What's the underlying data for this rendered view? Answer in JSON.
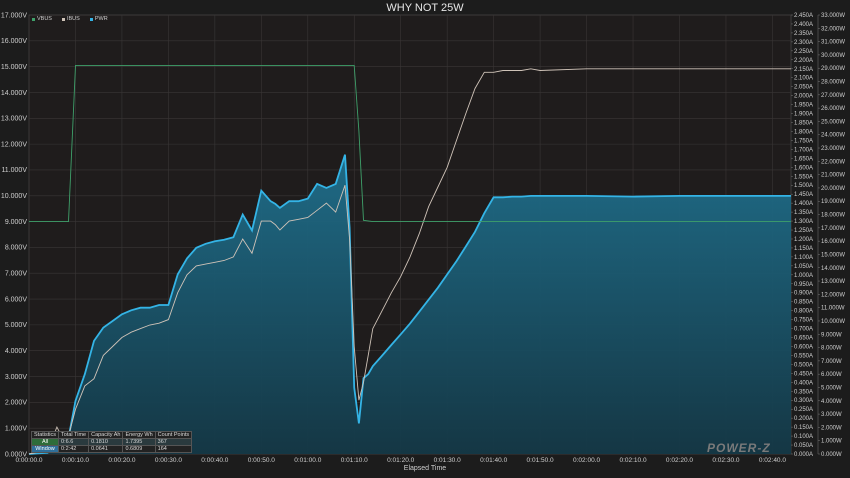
{
  "chart_data": {
    "type": "line",
    "title": "WHY NOT 25W",
    "xlabel": "Elapsed Time",
    "x_unit": "seconds",
    "xlim": [
      0,
      164
    ],
    "x_ticks": [
      0,
      10,
      20,
      30,
      40,
      50,
      60,
      70,
      80,
      90,
      100,
      110,
      120,
      130,
      140,
      150,
      160
    ],
    "x_tick_labels": [
      "0:00:00.0",
      "0:00:10.0",
      "0:00:20.0",
      "0:00:30.0",
      "0:00:40.0",
      "0:00:50.0",
      "0:01:00.0",
      "0:01:10.0",
      "0:01:20.0",
      "0:01:30.0",
      "0:01:40.0",
      "0:01:50.0",
      "0:02:00.0",
      "0:02:10.0",
      "0:02:20.0",
      "0:02:30.0",
      "0:02:40.0"
    ],
    "y_left": {
      "unit": "V",
      "ylim": [
        0,
        17
      ],
      "step": 1,
      "tick_labels": [
        "0.000V",
        "1.000V",
        "2.000V",
        "3.000V",
        "4.000V",
        "5.000V",
        "6.000V",
        "7.000V",
        "8.000V",
        "9.000V",
        "10.000V",
        "11.000V",
        "12.000V",
        "13.000V",
        "14.000V",
        "15.000V",
        "16.000V",
        "17.000V"
      ]
    },
    "y_right_current": {
      "unit": "A",
      "ylim": [
        0,
        2.45
      ],
      "step": 0.05,
      "tick_labels": [
        "0.000A",
        "0.050A",
        "0.100A",
        "0.150A",
        "0.200A",
        "0.250A",
        "0.300A",
        "0.350A",
        "0.400A",
        "0.450A",
        "0.500A",
        "0.550A",
        "0.600A",
        "0.650A",
        "0.700A",
        "0.750A",
        "0.800A",
        "0.850A",
        "0.900A",
        "0.950A",
        "1.000A",
        "1.050A",
        "1.100A",
        "1.150A",
        "1.200A",
        "1.250A",
        "1.300A",
        "1.350A",
        "1.400A",
        "1.450A",
        "1.500A",
        "1.550A",
        "1.600A",
        "1.650A",
        "1.700A",
        "1.750A",
        "1.800A",
        "1.850A",
        "1.900A",
        "1.950A",
        "2.000A",
        "2.050A",
        "2.100A",
        "2.150A",
        "2.200A",
        "2.250A",
        "2.300A",
        "2.350A",
        "2.400A",
        "2.450A"
      ]
    },
    "y_right_power": {
      "unit": "W",
      "ylim": [
        0,
        33
      ],
      "step": 1,
      "tick_labels": [
        "0.000W",
        "1.000W",
        "2.000W",
        "3.000W",
        "4.000W",
        "5.000W",
        "6.000W",
        "7.000W",
        "8.000W",
        "9.000W",
        "10.000W",
        "11.000W",
        "12.000W",
        "13.000W",
        "14.000W",
        "15.000W",
        "16.000W",
        "17.000W",
        "18.000W",
        "19.000W",
        "20.000W",
        "21.000W",
        "22.000W",
        "23.000W",
        "24.000W",
        "25.000W",
        "26.000W",
        "27.000W",
        "28.000W",
        "29.000W",
        "30.000W",
        "31.000W",
        "32.000W",
        "33.000W"
      ]
    },
    "grid": true,
    "legend_position": "top-left",
    "series": [
      {
        "name": "VBUS",
        "axis": "left",
        "color": "#3fa06a",
        "x": [
          0,
          8.5,
          10,
          70,
          71,
          72,
          74,
          164
        ],
        "y": [
          9.0,
          9.0,
          15.05,
          15.05,
          12.5,
          9.05,
          9.0,
          9.0
        ]
      },
      {
        "name": "IBUS",
        "axis": "right_current",
        "color": "#cfc3b8",
        "x": [
          0,
          4,
          6,
          8,
          10,
          12,
          14,
          16,
          18,
          20,
          22,
          24,
          26,
          28,
          30,
          32,
          34,
          36,
          38,
          40,
          42,
          44,
          46,
          48,
          50,
          52,
          53,
          54,
          56,
          58,
          60,
          62,
          64,
          66,
          68,
          69,
          70,
          71,
          72,
          73,
          74,
          76,
          78,
          80,
          82,
          84,
          86,
          88,
          90,
          92,
          94,
          96,
          98,
          100,
          102,
          104,
          106,
          108,
          110,
          120,
          130,
          140,
          150,
          160,
          164
        ],
        "y": [
          0,
          0.02,
          0.15,
          0.05,
          0.25,
          0.38,
          0.42,
          0.55,
          0.6,
          0.65,
          0.68,
          0.7,
          0.72,
          0.73,
          0.75,
          0.9,
          1.0,
          1.05,
          1.06,
          1.07,
          1.08,
          1.1,
          1.2,
          1.12,
          1.3,
          1.3,
          1.28,
          1.25,
          1.3,
          1.31,
          1.32,
          1.36,
          1.4,
          1.35,
          1.5,
          1.2,
          0.6,
          0.3,
          0.4,
          0.55,
          0.7,
          0.8,
          0.9,
          0.99,
          1.1,
          1.23,
          1.38,
          1.49,
          1.6,
          1.75,
          1.9,
          2.04,
          2.13,
          2.13,
          2.14,
          2.14,
          2.14,
          2.15,
          2.14,
          2.15,
          2.15,
          2.15,
          2.15,
          2.15,
          2.15
        ]
      },
      {
        "name": "PWR",
        "axis": "right_power",
        "color": "#34b4e6",
        "fill": true,
        "x": [
          0,
          4,
          6,
          8,
          10,
          12,
          14,
          16,
          18,
          20,
          22,
          24,
          26,
          28,
          30,
          32,
          34,
          36,
          38,
          40,
          42,
          44,
          46,
          48,
          50,
          52,
          53,
          54,
          56,
          58,
          60,
          62,
          64,
          66,
          68,
          69,
          70,
          71,
          72,
          73,
          74,
          76,
          78,
          80,
          82,
          84,
          86,
          88,
          90,
          92,
          94,
          96,
          98,
          100,
          102,
          104,
          106,
          108,
          110,
          120,
          130,
          140,
          150,
          160,
          164
        ],
        "y": [
          0,
          0.1,
          1.0,
          0.3,
          4.0,
          6.0,
          8.5,
          9.5,
          10.0,
          10.5,
          10.8,
          11.0,
          11.0,
          11.2,
          11.2,
          13.5,
          14.7,
          15.5,
          15.8,
          16.0,
          16.1,
          16.3,
          18.0,
          16.8,
          19.8,
          19.0,
          18.8,
          18.5,
          19.0,
          19.0,
          19.2,
          20.3,
          20.0,
          20.3,
          22.5,
          17.0,
          5.0,
          2.3,
          5.7,
          6.0,
          6.6,
          7.4,
          8.2,
          9.0,
          9.8,
          10.7,
          11.6,
          12.5,
          13.5,
          14.5,
          15.6,
          16.7,
          18.1,
          19.3,
          19.3,
          19.35,
          19.35,
          19.4,
          19.4,
          19.4,
          19.35,
          19.4,
          19.4,
          19.4,
          19.4
        ]
      }
    ]
  },
  "stats_table": {
    "headers": [
      "Statistics",
      "Total Time",
      "Capacity Ah",
      "Energy Wh",
      "Count Points"
    ],
    "rows": [
      [
        "All",
        "0:6.6",
        "0.1810",
        "1.7395",
        "367"
      ],
      [
        "Window",
        "0:2:42",
        "0.0641",
        "0.6809",
        "164"
      ]
    ]
  },
  "logo_text": "POWER-Z"
}
